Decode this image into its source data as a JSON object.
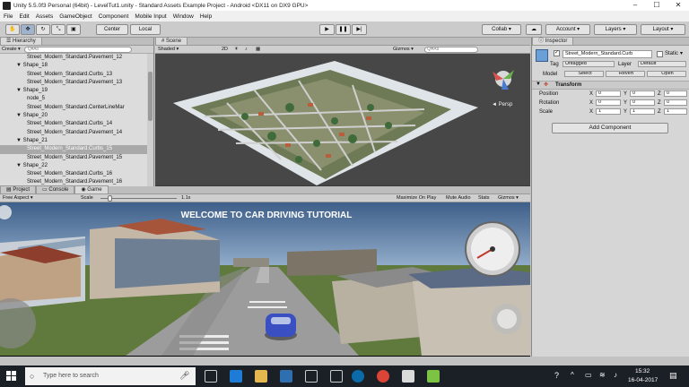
{
  "window": {
    "title": "Unity 5.5.0f3 Personal (64bit) - LevelTut1.unity - Standard Assets Example Project - Android <DX11 on DX9 GPU>"
  },
  "menu": [
    "File",
    "Edit",
    "Assets",
    "GameObject",
    "Component",
    "Mobile Input",
    "Window",
    "Help"
  ],
  "toolbar": {
    "center": "Center",
    "local": "Local",
    "collab": "Collab",
    "account": "Account",
    "layers": "Layers",
    "layout": "Layout"
  },
  "hierarchy": {
    "tab": "Hierarchy",
    "create": "Create",
    "search_placeholder": "Q▾All",
    "rows": [
      "Street_Modern_Standard.Pavement_12",
      "▼ Shape_18",
      "Street_Modern_Standard.Curbs_13",
      "Street_Modern_Standard.Pavement_13",
      "▼ Shape_19",
      "node_5",
      "Street_Modern_Standard.CenterLineMar",
      "▼ Shape_20",
      "Street_Modern_Standard.Curbs_14",
      "Street_Modern_Standard.Pavement_14",
      "▼ Shape_21",
      "Street_Modern_Standard.Curbs_15",
      "Street_Modern_Standard.Pavement_15",
      "▼ Shape_22",
      "Street_Modern_Standard.Curbs_16",
      "Street_Modern_Standard.Pavement_16"
    ]
  },
  "scene": {
    "tab": "Scene",
    "shaded": "Shaded",
    "mode2d": "2D",
    "gizmos": "Gizmos",
    "search_placeholder": "Q▾All",
    "persp": "◄ Persp",
    "gizmo_axes": {
      "x": "x",
      "y": "y",
      "z": "z"
    }
  },
  "bottom_tabs": {
    "project": "Project",
    "console": "Console",
    "game": "Game"
  },
  "game": {
    "aspect": "Free Aspect",
    "scale_label": "Scale",
    "scale_value": "1.1x",
    "maximize": "Maximize On Play",
    "mute": "Mute Audio",
    "stats": "Stats",
    "gizmos": "Gizmos",
    "banner": "WELCOME TO CAR DRIVING TUTORIAL"
  },
  "inspector": {
    "tab": "Inspector",
    "object_name": "Street_Modern_Standard.Curb",
    "static_label": "Static",
    "tag_label": "Tag",
    "tag_value": "Untagged",
    "layer_label": "Layer",
    "layer_value": "Default",
    "model_label": "Model",
    "model_select": "Select",
    "model_revert": "Revert",
    "model_open": "Open",
    "transform_title": "Transform",
    "position_label": "Position",
    "rotation_label": "Rotation",
    "scale_label": "Scale",
    "position": {
      "x": "0",
      "y": "0",
      "z": "0"
    },
    "rotation": {
      "x": "0",
      "y": "0",
      "z": "0"
    },
    "scale": {
      "x": "1",
      "y": "1",
      "z": "1"
    },
    "axis_x": "X",
    "axis_y": "Y",
    "axis_z": "Z",
    "add_component": "Add Component"
  },
  "taskbar": {
    "search_placeholder": "Type here to search",
    "time": "15:32",
    "date": "16-04-2017"
  },
  "colors": {
    "unity_gray": "#c2c2c2",
    "selection": "#a9a9a9",
    "taskbar": "#1b1f26",
    "sky": "#6a8fb8",
    "grass": "#5f7a3c"
  }
}
